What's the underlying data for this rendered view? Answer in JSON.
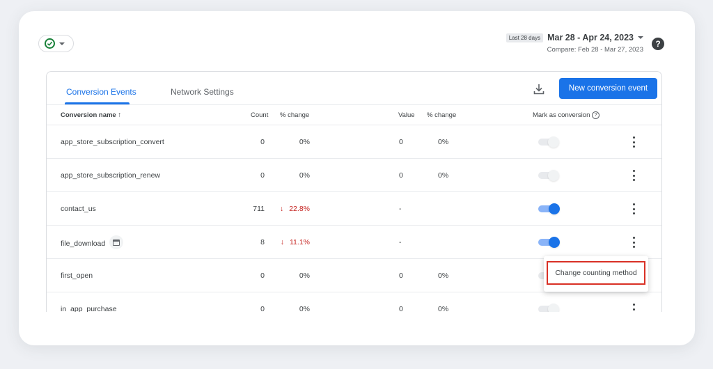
{
  "header": {
    "date_badge": "Last 28 days",
    "date_range": "Mar 28 - Apr 24, 2023",
    "compare": "Compare: Feb 28 - Mar 27, 2023"
  },
  "tabs": [
    {
      "label": "Conversion Events",
      "active": true
    },
    {
      "label": "Network Settings",
      "active": false
    }
  ],
  "new_button_label": "New conversion event",
  "columns": {
    "name": "Conversion name",
    "sort_arrow": "↑",
    "count": "Count",
    "count_change": "% change",
    "value": "Value",
    "value_change": "% change",
    "mark": "Mark as conversion"
  },
  "rows": [
    {
      "name": "app_store_subscription_convert",
      "count": "0",
      "count_change": "0%",
      "value": "0",
      "value_change": "0%",
      "toggle_on": false
    },
    {
      "name": "app_store_subscription_renew",
      "count": "0",
      "count_change": "0%",
      "value": "0",
      "value_change": "0%",
      "toggle_on": false
    },
    {
      "name": "contact_us",
      "count": "711",
      "count_change": "22.8%",
      "value": "-",
      "value_change": "",
      "toggle_on": true
    },
    {
      "name": "file_download",
      "count": "8",
      "count_change": "11.1%",
      "value": "-",
      "value_change": "",
      "toggle_on": true
    },
    {
      "name": "first_open",
      "count": "0",
      "count_change": "0%",
      "value": "0",
      "value_change": "0%",
      "toggle_on": false
    },
    {
      "name": "in_app_purchase",
      "count": "0",
      "count_change": "0%",
      "value": "0",
      "value_change": "0%",
      "toggle_on": false
    }
  ],
  "context_menu": {
    "item": "Change counting method"
  },
  "colors": {
    "accent": "#1a73e8",
    "negative": "#c5221f",
    "highlight_border": "#d93025"
  }
}
